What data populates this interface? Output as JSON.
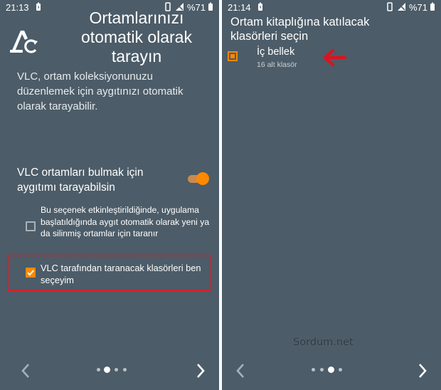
{
  "left_screen": {
    "status": {
      "time": "21:13",
      "battery_pct": "%71"
    },
    "title": "Ortamlarınızı otomatik olarak tarayın",
    "description": "VLC, ortam koleksiyonunuzu düzenlemek için aygıtınızı otomatik olarak tarayabilir.",
    "scan_label": "VLC ortamları bulmak için aygıtımı tarayabilsin",
    "scan_toggle_on": true,
    "option_auto_scan": "Bu seçenek etkinleştirildiğinde, uygulama başlatıldığında aygıt otomatik olarak yeni ya da silinmiş ortamlar için taranır",
    "option_choose_folders": "VLC tarafından taranacak klasörleri ben seçeyim",
    "page_index": 1,
    "page_count": 4
  },
  "right_screen": {
    "status": {
      "time": "21:14",
      "battery_pct": "%71"
    },
    "title": "Ortam kitaplığına katılacak klasörleri seçin",
    "folder_name": "İç bellek",
    "folder_sub": "16 alt klasör",
    "page_index": 2,
    "page_count": 4
  },
  "watermark": "Sordum.net",
  "colors": {
    "background": "#4c5c68",
    "accent": "#ff8800",
    "highlight": "#d81e2a"
  },
  "icons": [
    "vlc-cone-icon",
    "battery-charging-icon",
    "vibrate-icon",
    "no-signal-icon",
    "battery-icon",
    "check-icon",
    "chevron-left-icon",
    "chevron-right-icon",
    "red-arrow-icon"
  ]
}
